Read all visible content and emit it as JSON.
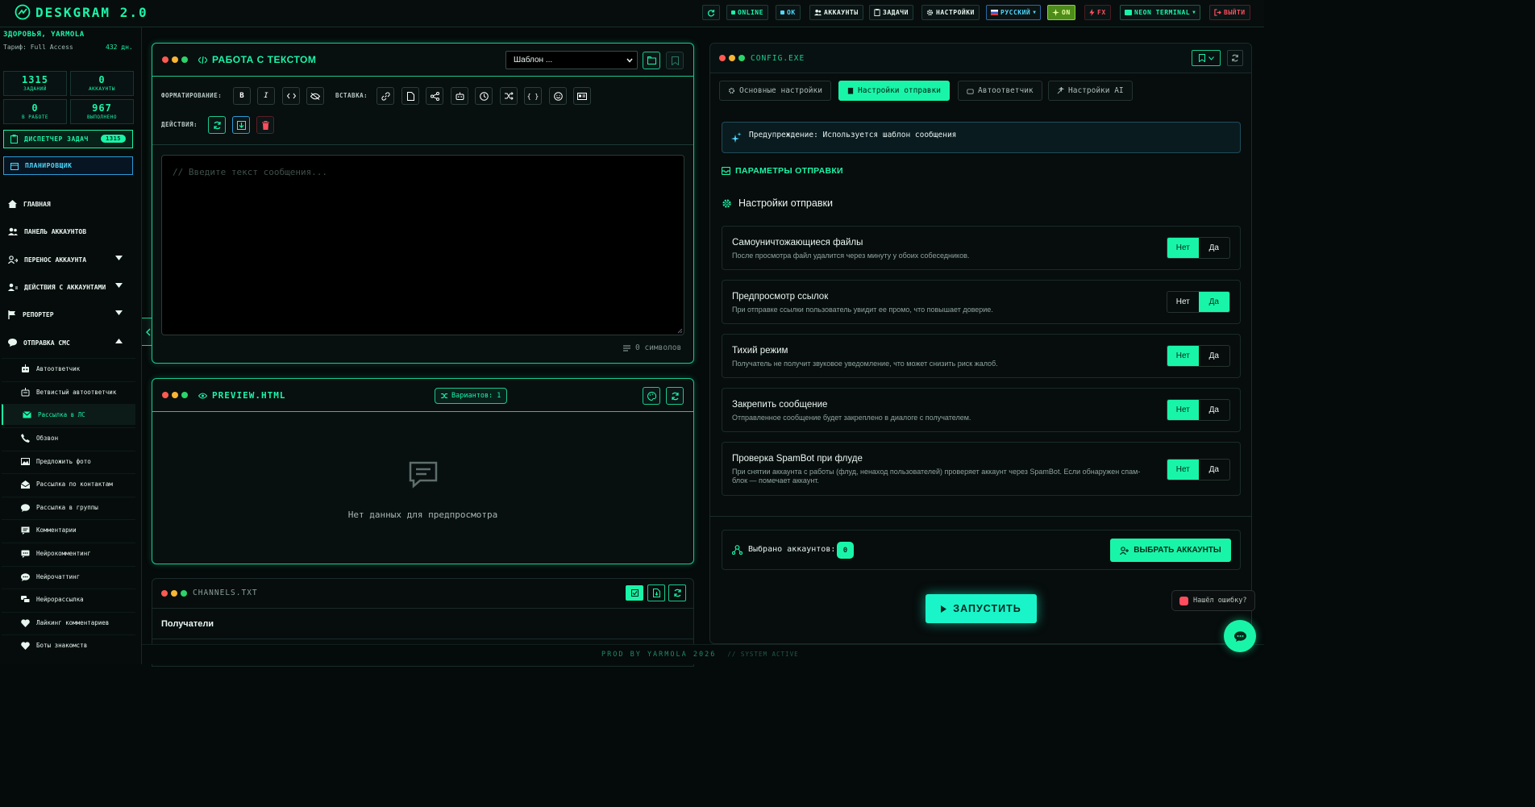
{
  "topbar": {
    "app_name": "DESKGRAM 2.0",
    "online": "ONLINE",
    "ok": "OK",
    "accounts": "АККАУНТЫ",
    "tasks": "ЗАДАЧИ",
    "settings": "НАСТРОЙКИ",
    "language": "РУССКИЙ",
    "on": "ON",
    "fx": "FX",
    "theme": "NEON TERMINAL",
    "logout": "ВЫЙТИ"
  },
  "sidebar": {
    "greeting": "ЗДОРОВЬЯ, YARMOLA",
    "tariff": "Тариф: Full Access",
    "days": "432 дн.",
    "stats": [
      {
        "value": "1315",
        "label": "ЗАДАНИЙ"
      },
      {
        "value": "0",
        "label": "АККАУНТЫ"
      },
      {
        "value": "0",
        "label": "В РАБОТЕ"
      },
      {
        "value": "967",
        "label": "ВЫПОЛНЕНО"
      }
    ],
    "dispatcher": "ДИСПЕТЧЕР ЗАДАЧ",
    "dispatcher_count": "1315",
    "planner": "ПЛАНИРОВЩИК",
    "nav": [
      {
        "label": "ГЛАВНАЯ"
      },
      {
        "label": "ПАНЕЛЬ АККАУНТОВ"
      },
      {
        "label": "ПЕРЕНОС АККАУНТА"
      },
      {
        "label": "ДЕЙСТВИЯ С АККАУНТАМИ"
      },
      {
        "label": "РЕПОРТЕР"
      },
      {
        "label": "ОТПРАВКА СМС"
      }
    ],
    "sub": [
      {
        "label": "Автоответчик"
      },
      {
        "label": "Ветвистый автоответчик"
      },
      {
        "label": "Рассылка в ЛС"
      },
      {
        "label": "Обзвон"
      },
      {
        "label": "Предложить фото"
      },
      {
        "label": "Рассылка по контактам"
      },
      {
        "label": "Рассылка в группы"
      },
      {
        "label": "Комментарии"
      },
      {
        "label": "Нейрокомментинг"
      },
      {
        "label": "Нейрочаттинг"
      },
      {
        "label": "Нейрорассылка"
      },
      {
        "label": "Лайкинг комментариев"
      },
      {
        "label": "Боты знакомств"
      }
    ]
  },
  "editor": {
    "title": "РАБОТА С ТЕКСТОМ",
    "template_select": "Шаблон ...",
    "formatting_label": "ФОРМАТИРОВАНИЕ:",
    "insert_label": "ВСТАВКА:",
    "actions_label": "ДЕЙСТВИЯ:",
    "placeholder": "// Введите текст сообщения...",
    "char_count": "0 символов"
  },
  "preview": {
    "title": "PREVIEW.HTML",
    "variants": "Вариантов: 1",
    "empty": "Нет данных для предпросмотра"
  },
  "channels": {
    "title": "CHANNELS.TXT",
    "recipients": "Получатели"
  },
  "config": {
    "title": "CONFIG.EXE",
    "tabs": [
      {
        "label": "Основные настройки"
      },
      {
        "label": "Настройки отправки"
      },
      {
        "label": "Автоответчик"
      },
      {
        "label": "Настройки AI"
      }
    ],
    "warning": "Предупреждение: Используется шаблон сообщения",
    "section_label": "ПАРАМЕТРЫ ОТПРАВКИ",
    "section_title": "Настройки отправки",
    "settings": [
      {
        "title": "Самоуничтожающиеся файлы",
        "desc": "После просмотра файл удалится через минуту у обоих собеседников.",
        "value": "Нет"
      },
      {
        "title": "Предпросмотр ссылок",
        "desc": "При отправке ссылки пользователь увидит ее промо, что повышает доверие.",
        "value": "Да"
      },
      {
        "title": "Тихий режим",
        "desc": "Получатель не получит звуковое уведомление, что может снизить риск жалоб.",
        "value": "Нет"
      },
      {
        "title": "Закрепить сообщение",
        "desc": "Отправленное сообщение будет закреплено в диалоге с получателем.",
        "value": "Нет"
      },
      {
        "title": "Проверка SpamBot при флуде",
        "desc": "При снятии аккаунта с работы (флуд, ненаход пользователей) проверяет аккаунт через SpamBot. Если обнаружен спам-блок — помечает аккаунт.",
        "value": "Нет"
      }
    ],
    "no_label": "Нет",
    "yes_label": "Да",
    "selected_accounts_label": "Выбрано аккаунтов:",
    "selected_accounts_count": "0",
    "select_accounts": "ВЫБРАТЬ АККАУНТЫ",
    "launch": "ЗАПУСТИТЬ"
  },
  "footer": {
    "prod": "PROD BY YARMOLA 2026",
    "status": "// SYSTEM ACTIVE"
  },
  "bug_report": "Нашёл ошибку?",
  "colors": {
    "accent": "#19f5a8",
    "background": "#050a0a",
    "danger": "#ff4d5e"
  }
}
